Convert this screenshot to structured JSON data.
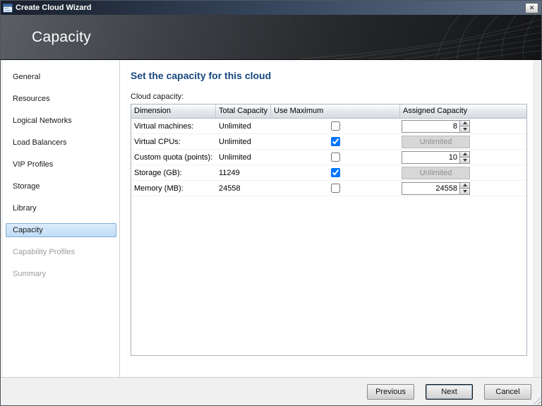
{
  "window": {
    "title": "Create Cloud Wizard",
    "close_glyph": "✕"
  },
  "banner": {
    "title": "Capacity"
  },
  "sidebar": {
    "items": [
      {
        "label": "General",
        "state": "normal"
      },
      {
        "label": "Resources",
        "state": "normal"
      },
      {
        "label": "Logical Networks",
        "state": "normal"
      },
      {
        "label": "Load Balancers",
        "state": "normal"
      },
      {
        "label": "VIP Profiles",
        "state": "normal"
      },
      {
        "label": "Storage",
        "state": "normal"
      },
      {
        "label": "Library",
        "state": "normal"
      },
      {
        "label": "Capacity",
        "state": "selected"
      },
      {
        "label": "Capability Profiles",
        "state": "disabled"
      },
      {
        "label": "Summary",
        "state": "disabled"
      }
    ]
  },
  "content": {
    "heading": "Set the capacity for this cloud",
    "table_label": "Cloud capacity:",
    "table": {
      "columns": [
        "Dimension",
        "Total Capacity",
        "Use Maximum",
        "Assigned Capacity"
      ],
      "rows": [
        {
          "dimension": "Virtual machines:",
          "total": "Unlimited",
          "use_maximum": false,
          "assigned": "8",
          "assigned_type": "spinner"
        },
        {
          "dimension": "Virtual CPUs:",
          "total": "Unlimited",
          "use_maximum": true,
          "assigned": "Unlimited",
          "assigned_type": "disabled"
        },
        {
          "dimension": "Custom quota (points):",
          "total": "Unlimited",
          "use_maximum": false,
          "assigned": "10",
          "assigned_type": "spinner"
        },
        {
          "dimension": "Storage (GB):",
          "total": "11249",
          "use_maximum": true,
          "assigned": "Unlimited",
          "assigned_type": "disabled"
        },
        {
          "dimension": "Memory (MB):",
          "total": "24558",
          "use_maximum": false,
          "assigned": "24558",
          "assigned_type": "spinner"
        }
      ]
    }
  },
  "footer": {
    "previous_label": "Previous",
    "next_label": "Next",
    "cancel_label": "Cancel"
  },
  "colors": {
    "heading_text": "#17477e",
    "selected_nav_bg": "#c1dcf7",
    "selected_nav_border": "#85add1",
    "banner_bg": "#2a2c30",
    "disabled_text": "#8f8f8f"
  }
}
